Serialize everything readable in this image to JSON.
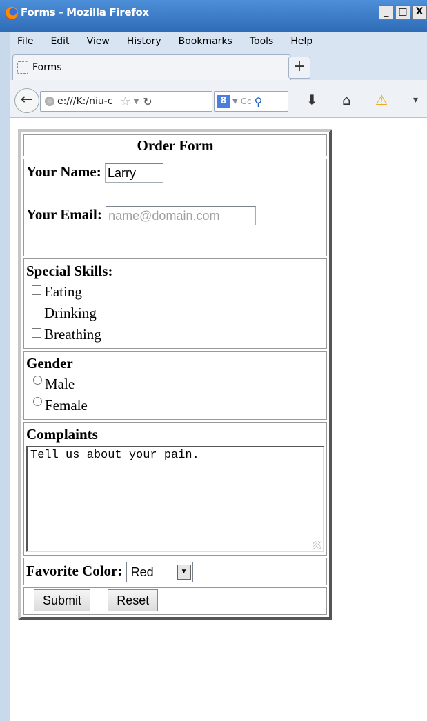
{
  "window": {
    "title": "Forms - Mozilla Firefox",
    "controls": [
      "_",
      "□",
      "X"
    ]
  },
  "menu": [
    "File",
    "Edit",
    "View",
    "History",
    "Bookmarks",
    "Tools",
    "Help"
  ],
  "tab": {
    "title": "Forms",
    "newtab_label": "+"
  },
  "navbar": {
    "back_label": "←",
    "url": "e:///K:/niu-c",
    "search_engine_badge": "8",
    "search_placeholder": "Gc",
    "download_label": "⬇",
    "home_label": "⌂",
    "warning_label": "⚠",
    "menu_label": "▾"
  },
  "form": {
    "title": "Order Form",
    "name_label": "Your Name:",
    "name_value": "Larry",
    "email_label": "Your Email:",
    "email_placeholder": "name@domain.com",
    "skills_label": "Special Skills:",
    "skills": [
      "Eating",
      "Drinking",
      "Breathing"
    ],
    "gender_label": "Gender",
    "genders": [
      "Male",
      "Female"
    ],
    "complaints_label": "Complaints",
    "complaints_value": "Tell us about your pain.",
    "color_label": "Favorite Color:",
    "color_value": "Red",
    "submit_label": "Submit",
    "reset_label": "Reset"
  }
}
